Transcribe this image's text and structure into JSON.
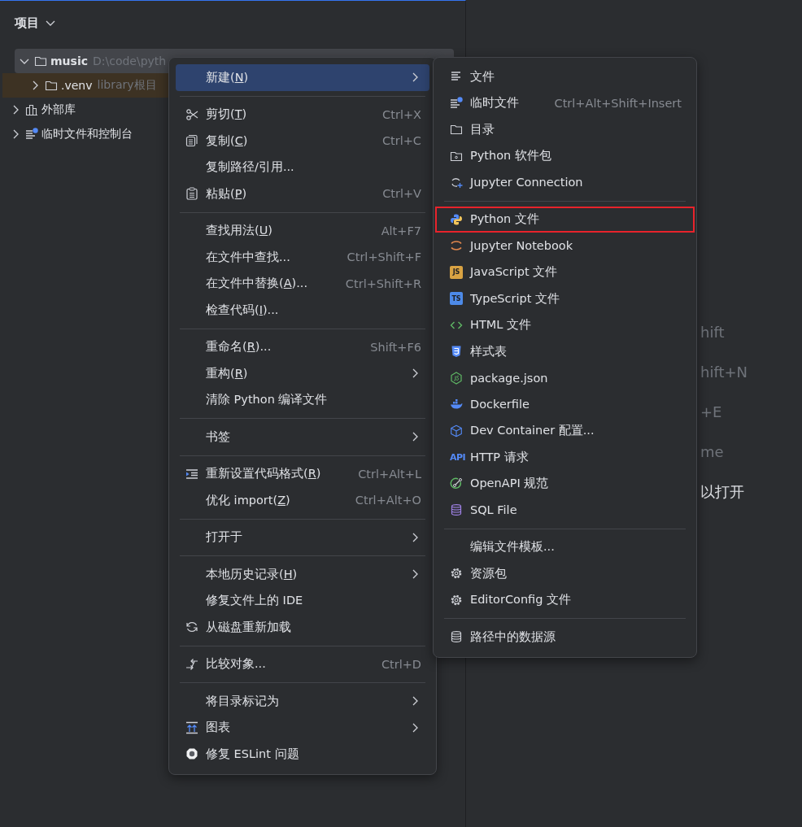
{
  "project_panel": {
    "title": "项目",
    "tree": [
      {
        "label": "music",
        "path": "D:\\code\\pyth",
        "kind": "folder",
        "selected": true,
        "expanded": true,
        "children": [
          {
            "label": ".venv",
            "path": "library根目",
            "kind": "library_root",
            "selected": false,
            "expanded": false
          }
        ]
      },
      {
        "label": "外部库",
        "kind": "libraries",
        "selected": false,
        "expanded": false
      },
      {
        "label": "临时文件和控制台",
        "kind": "scratches",
        "selected": false,
        "expanded": false
      }
    ]
  },
  "editor_hints": [
    {
      "text": "hift",
      "kind": "shortcut"
    },
    {
      "text": "hift+N",
      "kind": "shortcut"
    },
    {
      "text": "+E",
      "kind": "shortcut"
    },
    {
      "text": "me",
      "kind": "shortcut"
    },
    {
      "text": "以打开",
      "kind": "note"
    }
  ],
  "context_menu": [
    {
      "kind": "item",
      "label": "新建(",
      "mnemonic": "N",
      "label_end": ")",
      "submenu": true,
      "selected": true
    },
    {
      "kind": "separator"
    },
    {
      "kind": "item",
      "label": "剪切(",
      "mnemonic": "T",
      "label_end": ")",
      "shortcut": "Ctrl+X",
      "selected": false
    },
    {
      "kind": "item",
      "label": "复制(",
      "mnemonic": "C",
      "label_end": ")",
      "shortcut": "Ctrl+C",
      "selected": false
    },
    {
      "kind": "item",
      "label": "复制路径/引用...",
      "selected": false
    },
    {
      "kind": "item",
      "label": "粘贴(",
      "mnemonic": "P",
      "label_end": ")",
      "shortcut": "Ctrl+V",
      "selected": false
    },
    {
      "kind": "separator"
    },
    {
      "kind": "item",
      "label": "查找用法(",
      "mnemonic": "U",
      "label_end": ")",
      "shortcut": "Alt+F7",
      "selected": false
    },
    {
      "kind": "item",
      "label": "在文件中查找...",
      "shortcut": "Ctrl+Shift+F",
      "selected": false
    },
    {
      "kind": "item",
      "label": "在文件中替换(",
      "mnemonic": "A",
      "label_end": ")...",
      "shortcut": "Ctrl+Shift+R",
      "selected": false
    },
    {
      "kind": "item",
      "label": "检查代码(",
      "mnemonic": "I",
      "label_end": ")...",
      "selected": false
    },
    {
      "kind": "separator"
    },
    {
      "kind": "item",
      "label": "重命名(",
      "mnemonic": "R",
      "label_end": ")...",
      "shortcut": "Shift+F6",
      "selected": false
    },
    {
      "kind": "item",
      "label": "重构(",
      "mnemonic": "R",
      "label_end": ")",
      "submenu": true,
      "selected": false
    },
    {
      "kind": "item",
      "label": "清除 Python 编译文件",
      "selected": false
    },
    {
      "kind": "separator"
    },
    {
      "kind": "item",
      "label": "书签",
      "submenu": true,
      "selected": false
    },
    {
      "kind": "separator"
    },
    {
      "kind": "item",
      "label": "重新设置代码格式(",
      "mnemonic": "R",
      "label_end": ")",
      "shortcut": "Ctrl+Alt+L",
      "selected": false
    },
    {
      "kind": "item",
      "label": "优化 import(",
      "mnemonic": "Z",
      "label_end": ")",
      "shortcut": "Ctrl+Alt+O",
      "selected": false
    },
    {
      "kind": "separator"
    },
    {
      "kind": "item",
      "label": "打开于",
      "submenu": true,
      "selected": false
    },
    {
      "kind": "separator"
    },
    {
      "kind": "item",
      "label": "本地历史记录(",
      "mnemonic": "H",
      "label_end": ")",
      "submenu": true,
      "selected": false
    },
    {
      "kind": "item",
      "label": "修复文件上的 IDE",
      "selected": false
    },
    {
      "kind": "item",
      "label": "从磁盘重新加载",
      "selected": false
    },
    {
      "kind": "separator"
    },
    {
      "kind": "item",
      "label": "比较对象...",
      "shortcut": "Ctrl+D",
      "selected": false
    },
    {
      "kind": "separator"
    },
    {
      "kind": "item",
      "label": "将目录标记为",
      "submenu": true,
      "selected": false
    },
    {
      "kind": "item",
      "label": "图表",
      "submenu": true,
      "selected": false
    },
    {
      "kind": "item",
      "label": "修复 ESLint 问题",
      "selected": false
    }
  ],
  "new_submenu": [
    {
      "kind": "item",
      "label": "文件",
      "outlined": false
    },
    {
      "kind": "item",
      "label": "临时文件",
      "shortcut": "Ctrl+Alt+Shift+Insert",
      "outlined": false
    },
    {
      "kind": "item",
      "label": "目录",
      "outlined": false
    },
    {
      "kind": "item",
      "label": "Python 软件包",
      "outlined": false
    },
    {
      "kind": "item",
      "label": "Jupyter Connection",
      "outlined": false
    },
    {
      "kind": "separator"
    },
    {
      "kind": "item",
      "label": "Python 文件",
      "outlined": true
    },
    {
      "kind": "item",
      "label": "Jupyter Notebook",
      "outlined": false
    },
    {
      "kind": "item",
      "badge": "JS",
      "label": "JavaScript 文件",
      "outlined": false
    },
    {
      "kind": "item",
      "badge": "TS",
      "label": "TypeScript 文件",
      "outlined": false
    },
    {
      "kind": "item",
      "label": "HTML 文件",
      "outlined": false
    },
    {
      "kind": "item",
      "label": "样式表",
      "outlined": false
    },
    {
      "kind": "item",
      "label": "package.json",
      "outlined": false
    },
    {
      "kind": "item",
      "label": "Dockerfile",
      "outlined": false
    },
    {
      "kind": "item",
      "label": "Dev Container 配置...",
      "outlined": false
    },
    {
      "kind": "item",
      "badge": "API",
      "label": "HTTP 请求",
      "outlined": false
    },
    {
      "kind": "item",
      "label": "OpenAPI 规范",
      "outlined": false
    },
    {
      "kind": "item",
      "label": "SQL File",
      "outlined": false
    },
    {
      "kind": "separator"
    },
    {
      "kind": "item",
      "label": "编辑文件模板...",
      "outlined": false
    },
    {
      "kind": "item",
      "label": "资源包",
      "outlined": false
    },
    {
      "kind": "item",
      "label": "EditorConfig 文件",
      "outlined": false
    },
    {
      "kind": "separator"
    },
    {
      "kind": "item",
      "label": "路径中的数据源",
      "outlined": false
    }
  ]
}
